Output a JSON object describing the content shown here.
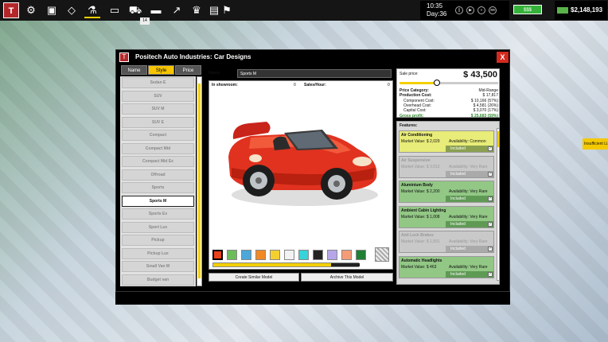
{
  "topbar": {
    "badge": "14",
    "time": "10:35",
    "day": "Day:36",
    "battery": "$$$",
    "money": "$2,148,193",
    "icons": [
      "logo-icon",
      "gear-icon",
      "save-icon",
      "road-icon",
      "microscope-icon",
      "tv-icon",
      "truck-icon",
      "car-icon",
      "chart-icon",
      "trophy-icon",
      "monitor-icon",
      "flag-icon"
    ]
  },
  "map": {
    "status_label": "Insufficient Li..."
  },
  "window": {
    "logo": "T",
    "title": "Positech Auto Industries: Car Designs",
    "close": "X",
    "tabs": [
      {
        "label": "Name"
      },
      {
        "label": "Style"
      },
      {
        "label": "Price"
      }
    ],
    "active_tab": "Style",
    "styles": [
      "Sedan E",
      "SUV",
      "SUV M",
      "SUV E",
      "Compact",
      "Compact Mid",
      "Compact Mid Ex",
      "Offroad",
      "Sports",
      "Sports M",
      "Sports Ex",
      "Sport Lux",
      "Pickup",
      "Pickup Lux",
      "Small Van M",
      "Budget van"
    ],
    "selected_style": "Sports M",
    "name_label": "Name:",
    "name_value": "Sports M",
    "in_showroom_label": "In showroom:",
    "in_showroom_value": "0",
    "sales_hour_label": "Sales/Hour:",
    "sales_hour_value": "0",
    "swatches": [
      "#e8421b",
      "#6cbd5a",
      "#4ba8d9",
      "#f18a25",
      "#f4d02f",
      "#f2f2f2",
      "#36d3d8",
      "#222222",
      "#b6a6e8",
      "#f59c77",
      "#1f7f34"
    ],
    "selected_swatch_index": 0,
    "buttons": {
      "create_similar": "Create Similar Model",
      "archive": "Archive This Model"
    },
    "pricing": {
      "sale_price_label": "Sale price:",
      "sale_price": "$ 43,500",
      "slider_fraction": 0.38,
      "rows": [
        {
          "label": "Price Category:",
          "value": "Mid-Range",
          "style": "b"
        },
        {
          "label": "Production Cost:",
          "value": "$ 17,817",
          "style": "b"
        },
        {
          "label": "Component Cost:",
          "value": "$ 10,166 (57%)",
          "style": "ind"
        },
        {
          "label": "Overhead Cost:",
          "value": "$ 4,581 (26%)",
          "style": "ind"
        },
        {
          "label": "Capital Cost:",
          "value": "$ 3,070 (17%)",
          "style": "ind"
        },
        {
          "label": "Gross profit:",
          "value": "$ 25,683 (59%)",
          "style": "gp"
        }
      ]
    },
    "features_label": "Features:",
    "features": [
      {
        "name": "Air Conditioning",
        "value_label": "Market Value:",
        "value": "$ 2,029",
        "avail_label": "Availability:",
        "avail": "Common",
        "included": "Included",
        "state": "yl"
      },
      {
        "name": "Air Suspension",
        "value_label": "Market Value:",
        "value": "$ 3,012",
        "avail_label": "Availability:",
        "avail": "Very Rare",
        "included": "Included",
        "state": "off"
      },
      {
        "name": "Aluminium Body",
        "value_label": "Market Value:",
        "value": "$ 2,200",
        "avail_label": "Availability:",
        "avail": "Very Rare",
        "included": "Included",
        "state": "on"
      },
      {
        "name": "Ambient Cabin Lighting",
        "value_label": "Market Value:",
        "value": "$ 1,008",
        "avail_label": "Availability:",
        "avail": "Very Rare",
        "included": "Included",
        "state": "on"
      },
      {
        "name": "Anti Lock Brakes",
        "value_label": "Market Value:",
        "value": "$ 1,501",
        "avail_label": "Availability:",
        "avail": "Very Rare",
        "included": "Included",
        "state": "off"
      },
      {
        "name": "Automatic Headlights",
        "value_label": "Market Value:",
        "value": "$ 463",
        "avail_label": "Availability:",
        "avail": "Very Rare",
        "included": "Included",
        "state": "on"
      }
    ]
  }
}
